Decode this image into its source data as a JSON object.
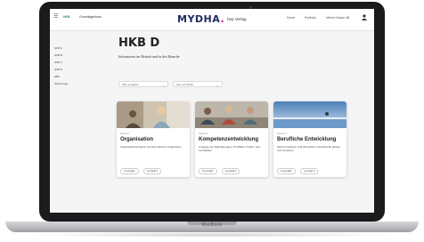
{
  "device": {
    "label": "MacBook"
  },
  "topbar": {
    "home": "HKB",
    "breadcrumb": "Grundlagenkurs",
    "logo": "MYDHA",
    "logo_dot": ".",
    "logo_sub": "hep Verlag",
    "links": [
      "Kurse",
      "Portfolio",
      "Meine Klasse 4B"
    ]
  },
  "sidebar": {
    "items": [
      "HKB A",
      "HKB B",
      "HKB C",
      "HKB D",
      "EBA",
      "Werkzeuge"
    ]
  },
  "page": {
    "title": "HKB D",
    "subtitle": "Informieren im Betrieb und in der Branche"
  },
  "filters": [
    {
      "value": "Alle Lernjahre"
    },
    {
      "value": "Alle Lernfelder"
    }
  ],
  "cards": [
    {
      "module": "Modul 1",
      "title": "Organisation",
      "description": "Organisationsstruktur mit Informationen analysieren",
      "pills": [
        "3 Lernjahr",
        "Lernfeld 1"
      ]
    },
    {
      "module": "Modul 2",
      "title": "Kompetenzentwicklung",
      "description": "Umgang mit Veränderungen, Konflikten, Kultur- und Lernfeldern",
      "pills": [
        "3 Lernjahr",
        "Lernfeld 2"
      ]
    },
    {
      "module": "Modul 3",
      "title": "Berufliche Entwicklung",
      "description": "Ziele formulieren und überprüfen, Goal-Suche planen und umsetzen",
      "pills": [
        "3 Lernjahr",
        "Lernfeld 3"
      ]
    }
  ],
  "colors": {
    "accent": "#2a8a6b",
    "brand": "#1c2a5e",
    "logo_dot": "#e2007a"
  },
  "icons": {
    "menu": "hamburger-icon",
    "user": "user-icon",
    "chevron": "chevron-down-icon"
  }
}
